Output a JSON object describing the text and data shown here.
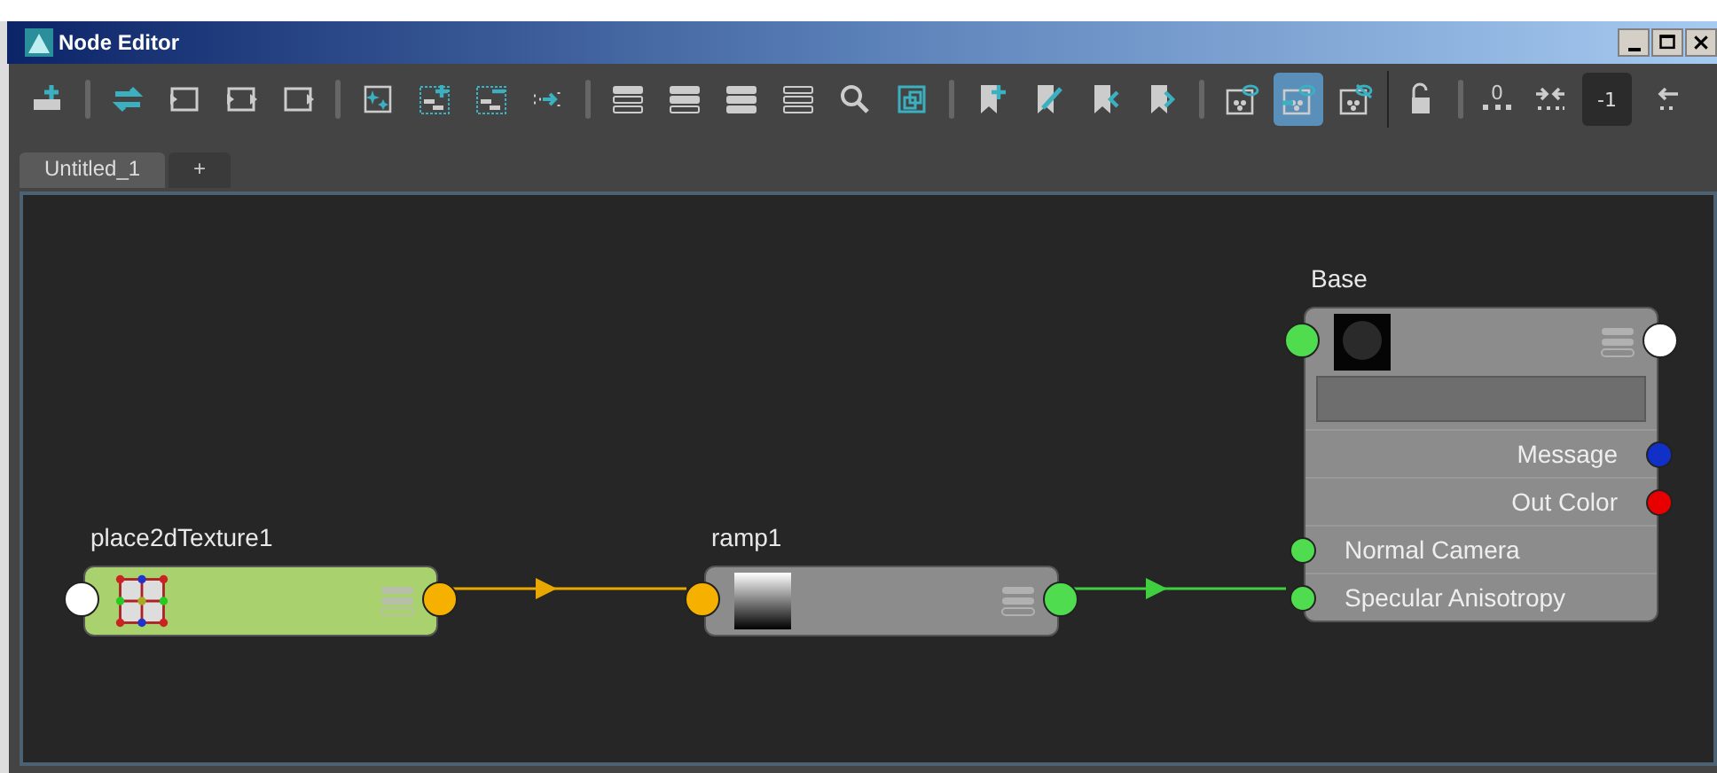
{
  "window": {
    "title": "Node Editor"
  },
  "toolbar": {
    "buttons": [
      {
        "selected": false
      },
      {
        "selected": false
      },
      {
        "selected": false
      },
      {
        "selected": false
      },
      {
        "selected": false
      },
      {
        "selected": false
      },
      {
        "selected": false
      },
      {
        "selected": false
      },
      {
        "selected": false
      },
      {
        "selected": false
      },
      {
        "selected": false
      },
      {
        "selected": false
      },
      {
        "selected": false
      },
      {
        "selected": false
      },
      {
        "selected": false
      },
      {
        "selected": false
      },
      {
        "selected": false
      },
      {
        "selected": false
      },
      {
        "selected": false
      },
      {
        "selected": false
      },
      {
        "selected": true
      },
      {
        "selected": false
      },
      {
        "selected": false
      },
      {
        "selected": false
      },
      {
        "selected": false
      }
    ],
    "counter_label": "0",
    "field_value": "-1"
  },
  "tabs": [
    {
      "label": "Untitled_1",
      "selected": true
    },
    {
      "label": "+",
      "selected": false
    }
  ],
  "nodes": [
    {
      "name": "place2dTexture1",
      "kind": "texture",
      "ports": [
        {
          "kind": "input",
          "color": "#ffffff"
        },
        {
          "kind": "output",
          "color": "#f5b000"
        }
      ]
    },
    {
      "name": "ramp1",
      "kind": "ramp",
      "ports": [
        {
          "kind": "input",
          "color": "#f5b000"
        },
        {
          "kind": "output",
          "color": "#4fdc4f"
        }
      ]
    },
    {
      "name": "Base",
      "kind": "material",
      "ports": [
        {
          "kind": "input",
          "color": "#4fdc4f"
        },
        {
          "kind": "output",
          "color": "#ffffff"
        }
      ],
      "attributes": [
        {
          "label": "Message",
          "kind": "output",
          "color": "#1030c8"
        },
        {
          "label": "Out Color",
          "kind": "output",
          "color": "#e80000"
        },
        {
          "label": "Normal Camera",
          "kind": "input",
          "color": "#4fdc4f"
        },
        {
          "label": "Specular Anisotropy",
          "kind": "input",
          "color": "#4fdc4f"
        }
      ]
    }
  ],
  "connections": [
    {
      "color": "#e8a800"
    },
    {
      "color": "#3fcf3f"
    }
  ]
}
